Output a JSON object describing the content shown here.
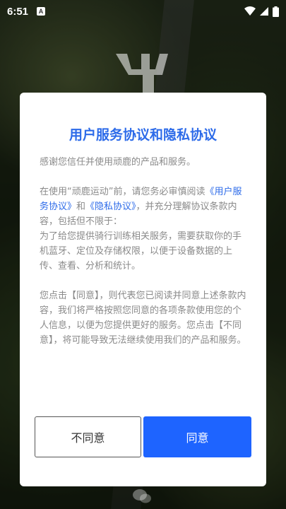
{
  "status_bar": {
    "time": "6:51",
    "notification_badge": "A",
    "icons": [
      "wifi-icon",
      "signal-icon",
      "battery-icon"
    ]
  },
  "dialog": {
    "title": "用户服务协议和隐私协议",
    "para1": "感谢您信任并使用顽鹿的产品和服务。",
    "para2_prefix": "在使用“顽鹿运动”前，请您务必审慎阅读",
    "link_user_agreement": "《用户服务协议》",
    "para2_and": "和",
    "link_privacy_agreement": "《隐私协议》",
    "para2_suffix": "，并充分理解协议条款内容，包括但不限于：",
    "para2_detail": "为了给您提供骑行训练相关服务，需要获取你的手机蓝牙、定位及存储权限，以便于设备数据的上传、查看、分析和统计。",
    "para3": "您点击【同意】，则代表您已阅读并同意上述条款内容，我们将严格按照您同意的各项条款使用您的个人信息，以便为您提供更好的服务。您点击【不同意】，将可能导致无法继续使用我们的产品和服务。",
    "disagree_label": "不同意",
    "agree_label": "同意"
  },
  "colors": {
    "accent": "#2d6be9",
    "agree_button": "#1e64ff",
    "body_text": "#8a8a8a"
  }
}
